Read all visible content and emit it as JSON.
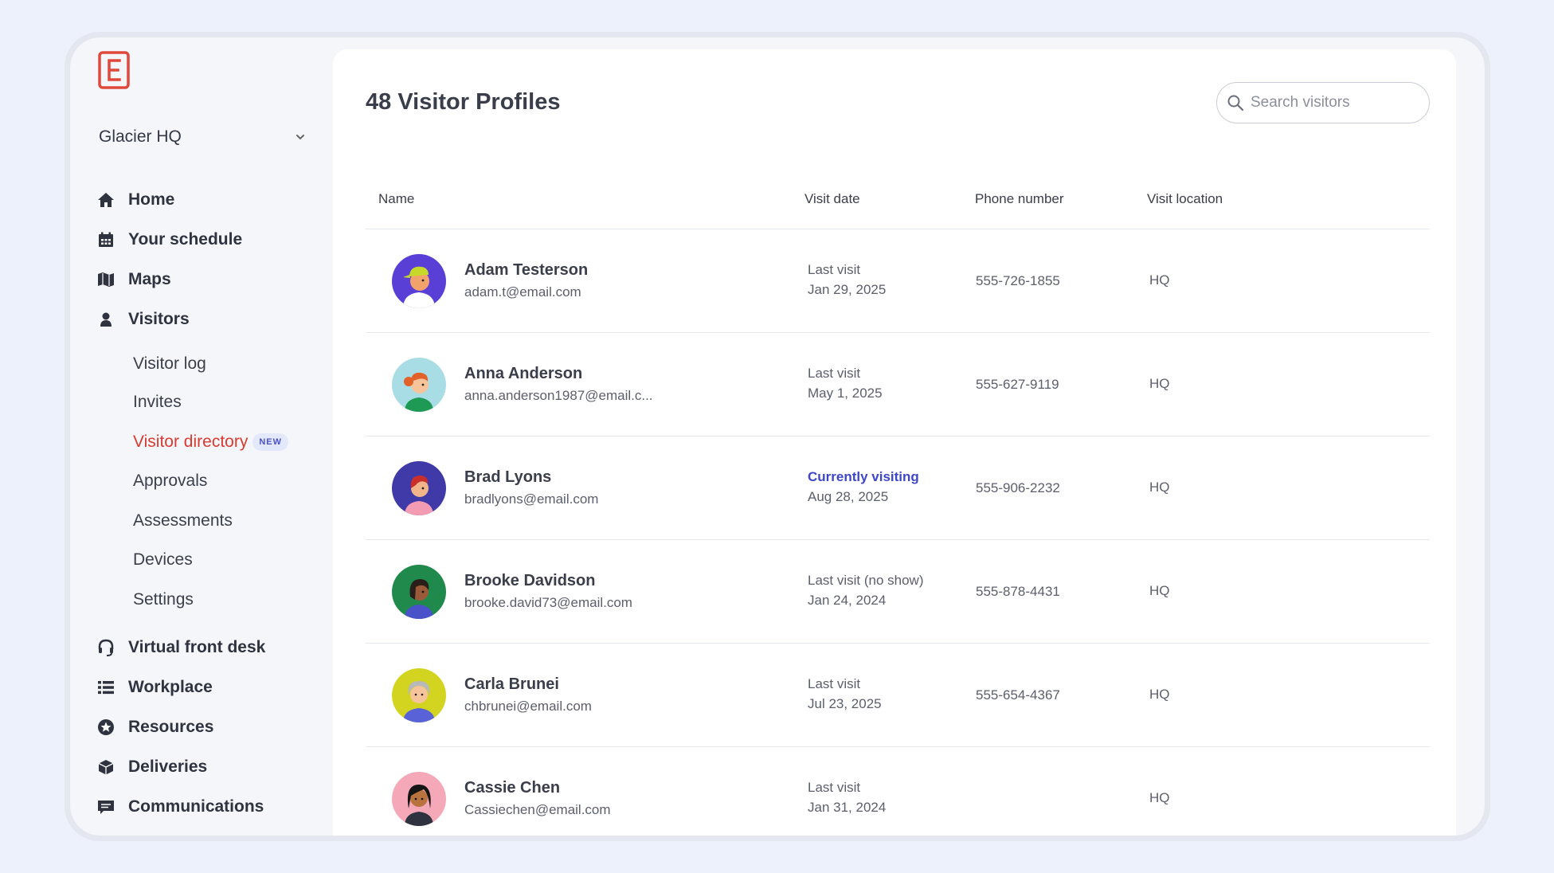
{
  "sidebar": {
    "location": "Glacier HQ",
    "nav": [
      {
        "label": "Home",
        "icon": "home-icon"
      },
      {
        "label": "Your schedule",
        "icon": "calendar-icon"
      },
      {
        "label": "Maps",
        "icon": "map-icon"
      },
      {
        "label": "Visitors",
        "icon": "visitor-icon"
      }
    ],
    "sub": [
      {
        "label": "Visitor log"
      },
      {
        "label": "Invites"
      },
      {
        "label": "Visitor directory",
        "active": true,
        "badge": "NEW"
      },
      {
        "label": "Approvals"
      },
      {
        "label": "Assessments"
      },
      {
        "label": "Devices"
      },
      {
        "label": "Settings"
      }
    ],
    "nav2": [
      {
        "label": "Virtual front desk",
        "icon": "headset-icon"
      },
      {
        "label": "Workplace",
        "icon": "list-icon"
      },
      {
        "label": "Resources",
        "icon": "star-icon"
      },
      {
        "label": "Deliveries",
        "icon": "package-icon"
      },
      {
        "label": "Communications",
        "icon": "message-icon"
      }
    ]
  },
  "main": {
    "title": "48 Visitor Profiles",
    "search_placeholder": "Search visitors",
    "columns": [
      "Name",
      "Visit date",
      "Phone number",
      "Visit location"
    ],
    "rows": [
      {
        "name": "Adam Testerson",
        "email": "adam.t@email.com",
        "visit_label": "Last visit",
        "visit_date": "Jan 29, 2025",
        "phone": "555-726-1855",
        "location": "HQ"
      },
      {
        "name": "Anna Anderson",
        "email": "anna.anderson1987@email.c...",
        "visit_label": "Last visit",
        "visit_date": "May 1, 2025",
        "phone": "555-627-9119",
        "location": "HQ"
      },
      {
        "name": "Brad Lyons",
        "email": "bradlyons@email.com",
        "visit_label": "Currently visiting",
        "visit_date": "Aug 28, 2025",
        "phone": "555-906-2232",
        "location": "HQ"
      },
      {
        "name": "Brooke Davidson",
        "email": "brooke.david73@email.com",
        "visit_label": "Last visit (no show)",
        "visit_date": "Jan 24, 2024",
        "phone": "555-878-4431",
        "location": "HQ"
      },
      {
        "name": "Carla Brunei",
        "email": "chbrunei@email.com",
        "visit_label": "Last visit",
        "visit_date": "Jul 23, 2025",
        "phone": "555-654-4367",
        "location": "HQ"
      },
      {
        "name": "Cassie Chen",
        "email": "Cassiechen@email.com",
        "visit_label": "Last visit",
        "visit_date": "Jan 31, 2024",
        "phone": "",
        "location": "HQ"
      }
    ]
  },
  "colors": {
    "accent_red": "#d93b30",
    "current_blue": "#3e47c8",
    "background": "#edf1fc"
  }
}
